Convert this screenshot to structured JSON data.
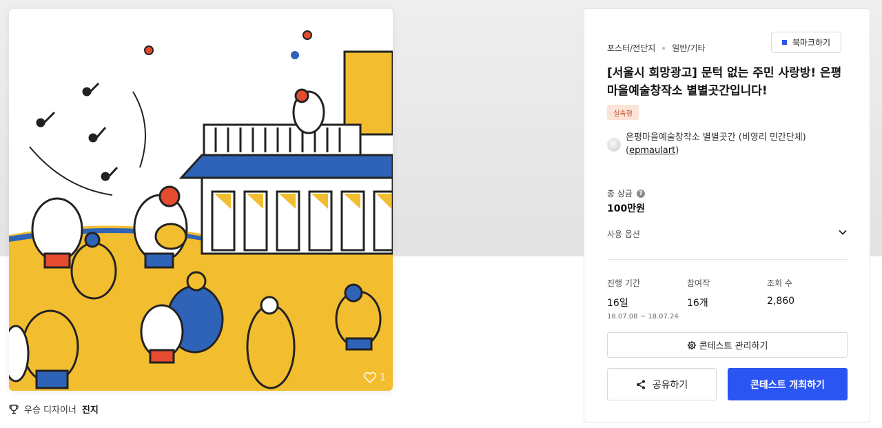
{
  "colors": {
    "accent": "#2a55f2",
    "badge_bg": "#fbe3d7",
    "badge_text": "#c0512a",
    "art_yellow": "#f2bd2f",
    "art_blue": "#2e63b8",
    "art_red": "#e54b2f"
  },
  "artwork": {
    "like_count": "1",
    "like_icon": "heart-outline-icon"
  },
  "winner": {
    "icon": "trophy-icon",
    "label": "우승 디자이너",
    "name": "진지"
  },
  "panel": {
    "breadcrumb": [
      "포스터/전단지",
      "일반/기타"
    ],
    "bookmark_label": "북마크하기",
    "title": "[서울시 희망광고] 문턱 없는 주민 사랑방! 은평마을예술창작소 별별곳간입니다!",
    "badge": "실속형",
    "host_name": "은평마을예술창작소 별별곳간 (비영리 민간단체) (",
    "host_handle": "epmaulart",
    "host_close": ")",
    "prize_label": "총 상금",
    "prize_value": "100만원",
    "usage_label": "사용 옵션",
    "stats": {
      "duration": {
        "label": "진행 기간",
        "value": "16일",
        "range": "18.07.08 ~ 18.07.24"
      },
      "entries": {
        "label": "참여작",
        "value": "16개"
      },
      "views": {
        "label": "조회 수",
        "value": "2,860"
      }
    },
    "manage_label": "콘테스트 관리하기",
    "share_label": "공유하기",
    "host_button_label": "콘테스트 개최하기"
  }
}
